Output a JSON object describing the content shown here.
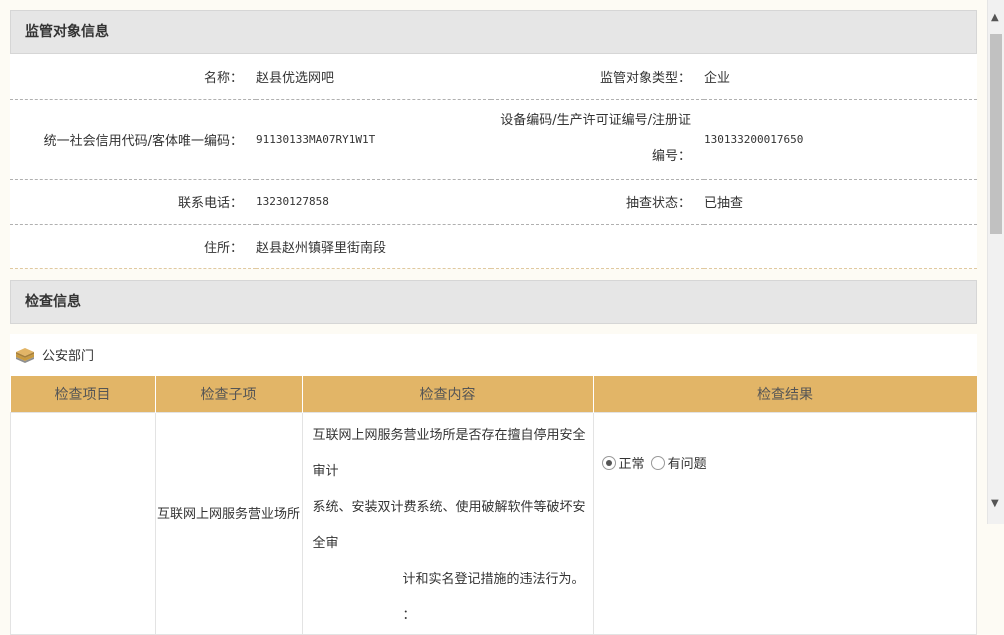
{
  "sections": {
    "supervision_title": "监管对象信息",
    "inspection_title": "检查信息"
  },
  "supervision": {
    "name_label": "名称：",
    "name_value": "赵县优选网吧",
    "type_label": "监管对象类型：",
    "type_value": "企业",
    "credit_label": "统一社会信用代码/客体唯一编码：",
    "credit_value": "91130133MA07RY1W1T",
    "device_label_line1": "设备编码/生产许可证编号/注册证",
    "device_label_line2": "编号：",
    "device_value": "130133200017650",
    "phone_label": "联系电话：",
    "phone_value": "13230127858",
    "status_label": "抽查状态：",
    "status_value": "已抽查",
    "address_label": "住所：",
    "address_value": "赵县赵州镇驿里街南段"
  },
  "department": {
    "icon": "stack-layers-icon",
    "name": "公安部门"
  },
  "check_table": {
    "headers": [
      "检查项目",
      "检查子项",
      "检查内容",
      "检查结果"
    ],
    "rows": [
      {
        "item": "",
        "subitem": "互联网上网服务营业场所",
        "content_line1": "互联网上网服务营业场所是否存在擅自停用安全审计",
        "content_line2": "系统、安装双计费系统、使用破解软件等破坏安全审",
        "content_line3": "计和实名登记措施的违法行为。 ：",
        "result_normal": "正常",
        "result_problem": "有问题"
      }
    ]
  },
  "colors": {
    "header_gold": "#e2b567",
    "section_gray": "#e6e6e6",
    "page_bg": "#fdfbf4"
  }
}
